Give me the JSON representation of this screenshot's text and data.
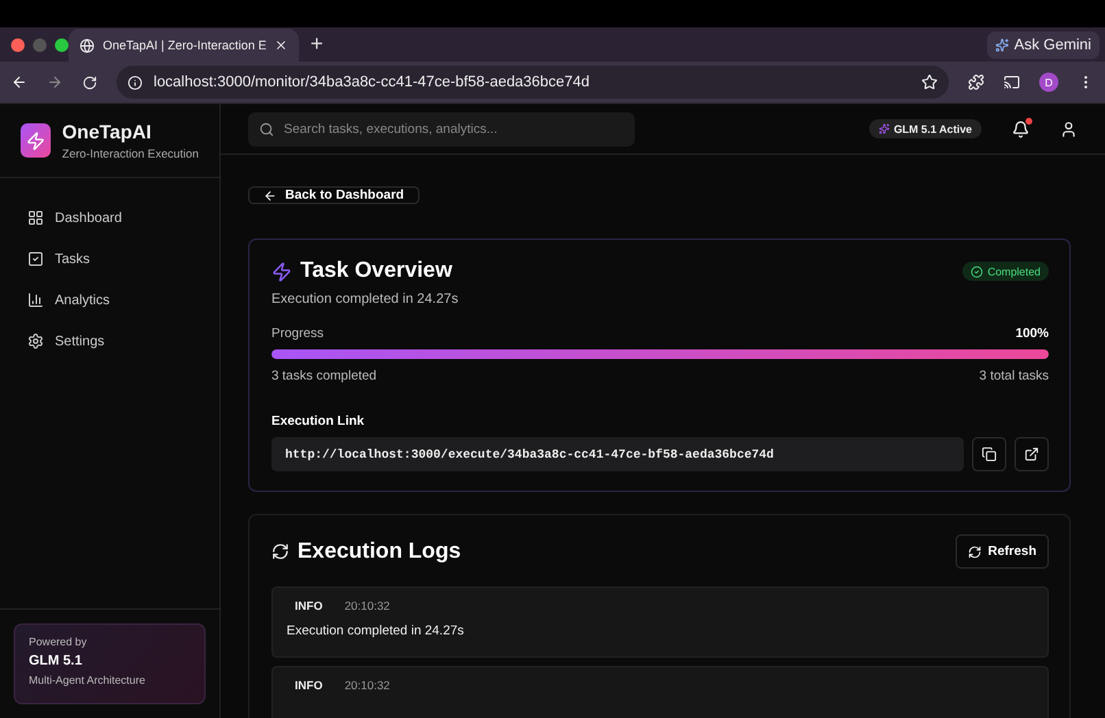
{
  "browser": {
    "tab_title": "OneTapAI | Zero-Interaction E",
    "new_tab": "+",
    "ask_button": "Ask Gemini",
    "url": "localhost:3000/monitor/34ba3a8c-cc41-47ce-bf58-aeda36bce74d",
    "profile": "D"
  },
  "sidebar": {
    "brand": "OneTapAI",
    "tagline": "Zero-Interaction Execution",
    "items": [
      {
        "label": "Dashboard",
        "selected": false
      },
      {
        "label": "Tasks",
        "selected": false
      },
      {
        "label": "Analytics",
        "selected": false
      },
      {
        "label": "Settings",
        "selected": false
      }
    ],
    "powered": {
      "label": "Powered by",
      "model": "GLM 5.1",
      "note": "Multi-Agent Architecture"
    }
  },
  "header": {
    "search_placeholder": "Search tasks, executions, analytics...",
    "model_badge": "GLM 5.1 Active",
    "has_notification": true
  },
  "back_button": "Back to Dashboard",
  "overview": {
    "title": "Task Overview",
    "status": "Completed",
    "subtitle": "Execution completed in 24.27s",
    "progress_label": "Progress",
    "progress_value": "100%",
    "level": 1,
    "completed": "3 tasks completed",
    "total": "3 total tasks",
    "link_label": "Execution Link",
    "link": "http://localhost:3000/execute/34ba3a8c-cc41-47ce-bf58-aeda36bce74d"
  },
  "logs": {
    "title": "Execution Logs",
    "refresh": "Refresh",
    "entries": [
      {
        "level": "INFO",
        "time": "20:10:32",
        "message": "Execution completed in 24.27s"
      },
      {
        "level": "INFO",
        "time": "20:10:32"
      }
    ]
  }
}
